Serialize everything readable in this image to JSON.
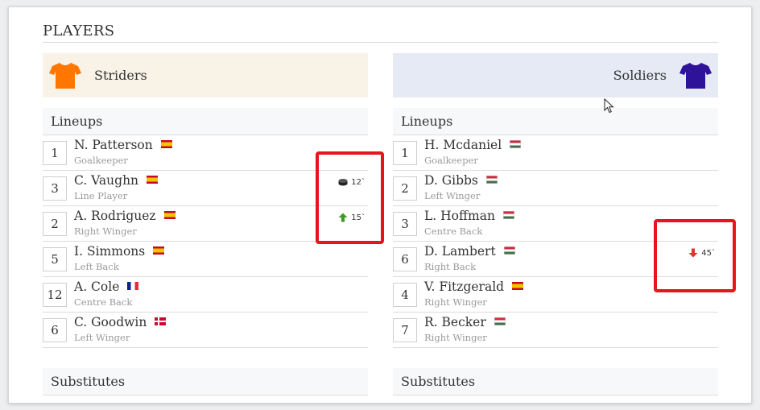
{
  "section_title": "PLAYERS",
  "colors": {
    "home_shirt": "#ff7700",
    "away_shirt": "#2e129a",
    "highlight": "#e8141c",
    "sub_in": "#3c9b1e",
    "sub_out": "#e4322b"
  },
  "home": {
    "name": "Striders",
    "lineups_label": "Lineups",
    "substitutes_label": "Substitutes",
    "players": [
      {
        "number": "1",
        "name": "N. Patterson",
        "position": "Goalkeeper",
        "flag": "es"
      },
      {
        "number": "3",
        "name": "C. Vaughn",
        "position": "Line Player",
        "flag": "es",
        "event": {
          "icon": "puck-icon",
          "minute": "12`"
        }
      },
      {
        "number": "2",
        "name": "A. Rodriguez",
        "position": "Right Winger",
        "flag": "es",
        "event": {
          "icon": "arrow-up-icon",
          "minute": "15`"
        }
      },
      {
        "number": "5",
        "name": "I. Simmons",
        "position": "Left Back",
        "flag": "es"
      },
      {
        "number": "12",
        "name": "A. Cole",
        "position": "Centre Back",
        "flag": "fr"
      },
      {
        "number": "6",
        "name": "C. Goodwin",
        "position": "Left Winger",
        "flag": "dk"
      }
    ]
  },
  "away": {
    "name": "Soldiers",
    "lineups_label": "Lineups",
    "substitutes_label": "Substitutes",
    "players": [
      {
        "number": "1",
        "name": "H. Mcdaniel",
        "position": "Goalkeeper",
        "flag": "hu"
      },
      {
        "number": "2",
        "name": "D. Gibbs",
        "position": "Left Winger",
        "flag": "hu"
      },
      {
        "number": "3",
        "name": "L. Hoffman",
        "position": "Centre Back",
        "flag": "hu"
      },
      {
        "number": "6",
        "name": "D. Lambert",
        "position": "Right Back",
        "flag": "hu",
        "event": {
          "icon": "arrow-down-icon",
          "minute": "45`"
        }
      },
      {
        "number": "4",
        "name": "V. Fitzgerald",
        "position": "Right Winger",
        "flag": "es"
      },
      {
        "number": "7",
        "name": "R. Becker",
        "position": "Right Winger",
        "flag": "hu"
      }
    ]
  }
}
